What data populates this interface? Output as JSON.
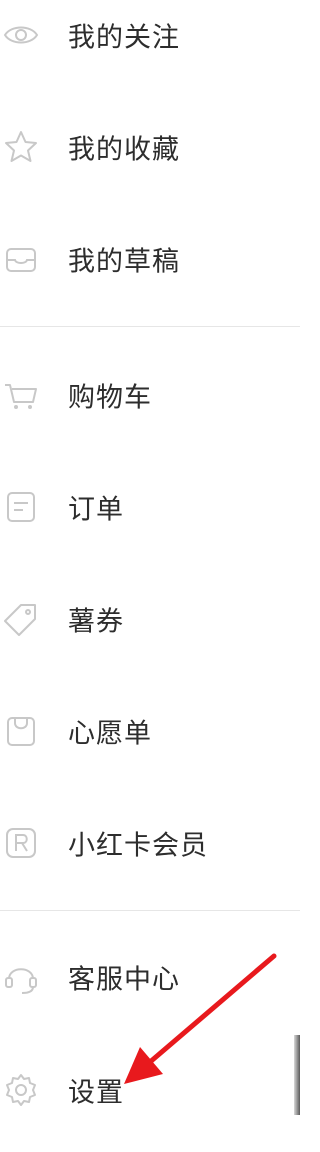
{
  "menu": {
    "items": [
      {
        "label": "我的关注",
        "icon": "eye-icon"
      },
      {
        "label": "我的收藏",
        "icon": "star-icon"
      },
      {
        "label": "我的草稿",
        "icon": "inbox-tray-icon"
      },
      {
        "label": "购物车",
        "icon": "shopping-cart-icon"
      },
      {
        "label": "订单",
        "icon": "order-document-icon"
      },
      {
        "label": "薯券",
        "icon": "coupon-tag-icon"
      },
      {
        "label": "心愿单",
        "icon": "wishlist-bag-icon"
      },
      {
        "label": "小红卡会员",
        "icon": "registered-r-icon"
      },
      {
        "label": "客服中心",
        "icon": "headset-icon"
      },
      {
        "label": "设置",
        "icon": "gear-icon"
      }
    ]
  },
  "colors": {
    "text": "#2d2d2d",
    "icon": "#c8c8c8",
    "divider": "#e6e6e6",
    "annotation_arrow": "#e8191d"
  }
}
